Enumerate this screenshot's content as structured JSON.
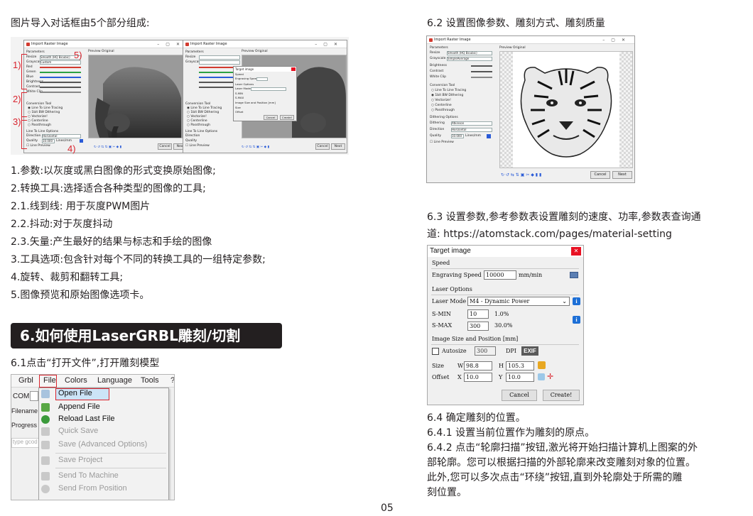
{
  "left": {
    "intro": "图片导入对话框由5个部分组成:",
    "items": [
      "1.参数:以灰度或黑白图像的形式变换原始图像;",
      "2.转换工具:选择适合各种类型的图像的工具;",
      "2.1.线到线: 用于灰度PWM图片",
      "2.2.抖动:对于灰度抖动",
      "2.3.矢量:产生最好的结果与标志和手绘的图像",
      "3.工具选项:包含针对每个不同的转换工具的一组特定参数;",
      "4.旋转、裁剪和翻转工具;",
      "5.图像预览和原始图像选项卡。"
    ],
    "section_title": "6.如何使用LaserGRBL雕刻/切割",
    "step_6_1": "6.1点击“打开文件”,打开雕刻模型",
    "markers": [
      "1)",
      "2)",
      "3)",
      "4)",
      "5)"
    ]
  },
  "raster_dialog": {
    "title": "Import Raster Image",
    "params_label": "Parameters",
    "preview_tab": "Preview",
    "original_tab": "Original",
    "rows": [
      "Resize",
      "Grayscale",
      "Red",
      "Green",
      "Blue",
      "Brightness",
      "Contrast",
      "White Clip"
    ],
    "resize_value": "Smooth (HQ Bicubic)",
    "grayscale_value": "Custom",
    "conversion_tool": "Conversion Tool",
    "tools": [
      "Line To Line Tracing",
      "1bit BW Dithering",
      "Vectorize!",
      "Centerline",
      "Passthrough"
    ],
    "line_options": "Line To Line Options",
    "direction": "Direction",
    "direction_value": "Horizontal",
    "quality": "Quality",
    "quality_value": "10.000",
    "quality_unit": "Lines/mm",
    "line_preview": "Line Preview",
    "cancel": "Cancel",
    "next": "Next"
  },
  "menu": {
    "tabs": [
      "Grbl",
      "File",
      "Colors",
      "Language",
      "Tools",
      "?"
    ],
    "side_labels": [
      "COM",
      "Filename",
      "Progress",
      "type gcod"
    ],
    "items": [
      {
        "label": "Open File",
        "enabled": true,
        "highlight": true
      },
      {
        "label": "Append File",
        "enabled": true
      },
      {
        "label": "Reload Last File",
        "enabled": true
      },
      {
        "label": "Quick Save",
        "enabled": false
      },
      {
        "label": "Save (Advanced Options)",
        "enabled": false
      },
      {
        "label": "Save Project",
        "enabled": false
      },
      {
        "label": "Send To Machine",
        "enabled": false
      },
      {
        "label": "Send From Position",
        "enabled": false
      }
    ]
  },
  "right": {
    "step_6_2": "6.2 设置图像参数、雕刻方式、雕刻质量",
    "step_6_3_a": "6.3 设置参数,参考参数表设置雕刻的速度、功率,参数表查询通",
    "step_6_3_b": "道: https://atomstack.com/pages/material-setting",
    "step_6_2_dialog": {
      "grayscale_value": "SimpleAverage",
      "tools": [
        "Line To Line Tracing",
        "1bit BW Dithering",
        "Vectorize!",
        "Centerline",
        "Passthrough"
      ],
      "dithering_options": "Dithering Options",
      "dithering": "Dithering",
      "dithering_value": "Atkinson",
      "brightness": "Brightness",
      "contrast": "Contrast"
    },
    "step_6_4": "6.4 确定雕刻的位置。",
    "step_6_4_1": "6.4.1 设置当前位置作为雕刻的原点。",
    "step_6_4_2_lines": [
      "6.4.2 点击“轮廓扫描”按钮,激光将开始扫描计算机上图案的外",
      "部轮廓。您可以根据扫描的外部轮廓来改变雕刻对象的位置。",
      "此外,您可以多次点击“环绕”按钮,直到外轮廓处于所需的雕",
      "刻位置。"
    ]
  },
  "target_dialog": {
    "title": "Target image",
    "speed_group": "Speed",
    "engraving_speed_label": "Engraving Speed",
    "engraving_speed_value": "10000",
    "speed_unit": "mm/min",
    "laser_options": "Laser Options",
    "laser_mode_label": "Laser Mode",
    "laser_mode_value": "M4 - Dynamic Power",
    "smin_label": "S-MIN",
    "smin_value": "10",
    "smin_pct": "1.0%",
    "smax_label": "S-MAX",
    "smax_value": "300",
    "smax_pct": "30.0%",
    "size_group": "Image Size and Position [mm]",
    "autosize": "Autosize",
    "dpi_value": "300",
    "dpi_label": "DPI",
    "exif": "EXIF",
    "size_label": "Size",
    "w_label": "W",
    "w_value": "98.8",
    "h_label": "H",
    "h_value": "105.3",
    "offset_label": "Offset",
    "x_label": "X",
    "x_value": "10.0",
    "y_label": "Y",
    "y_value": "10.0",
    "cancel": "Cancel",
    "create": "Create!"
  },
  "page_number": "05",
  "colors": {
    "section_bg": "#231f20",
    "marker": "#d9232d",
    "red_box": "#d9232d",
    "menu_highlight": "#cce4f7"
  }
}
